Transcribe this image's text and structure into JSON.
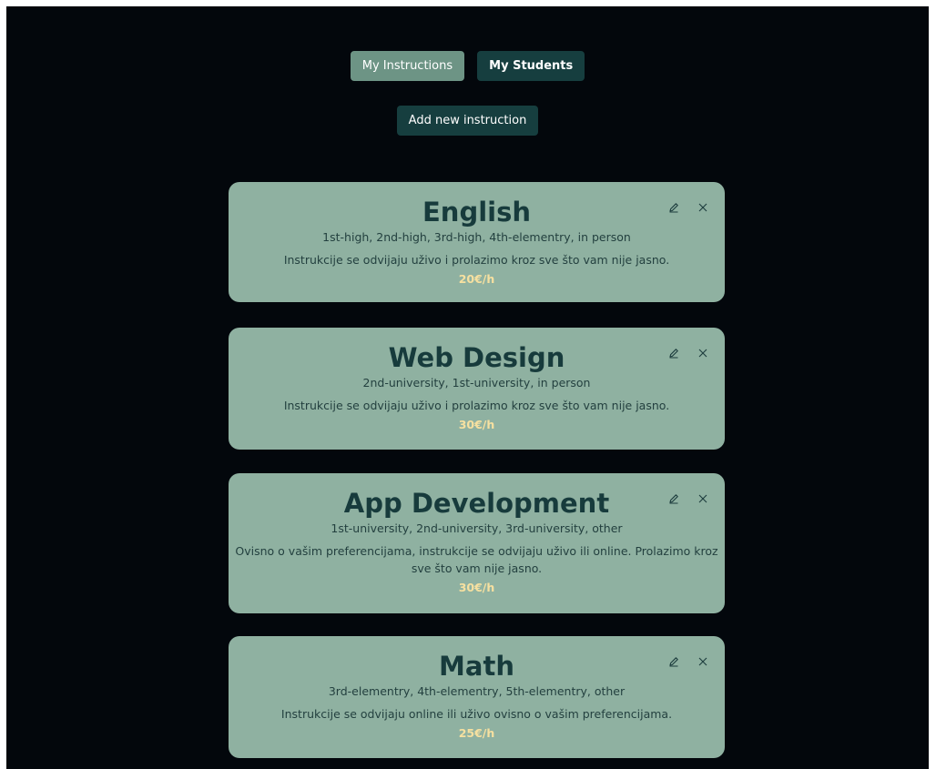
{
  "nav": {
    "my_instructions": "My Instructions",
    "my_students": "My Students",
    "add_new": "Add new instruction"
  },
  "colors": {
    "background": "#03070c",
    "card": "#8fb1a1",
    "active_button": "#6d9485",
    "dark_button": "#163e3f",
    "price": "#f6e0a0",
    "title": "#173b3c"
  },
  "instructions": [
    {
      "subject": "English",
      "levels": "1st-high, 2nd-high, 3rd-high, 4th-elementry, in person",
      "description": "Instrukcije se odvijaju uživo i prolazimo kroz sve što vam nije jasno.",
      "price": "20€/h",
      "edit_icon": "pencil-icon",
      "delete_icon": "close-icon"
    },
    {
      "subject": "Web Design",
      "levels": "2nd-university, 1st-university, in person",
      "description": "Instrukcije se odvijaju uživo i prolazimo kroz sve što vam nije jasno.",
      "price": "30€/h",
      "edit_icon": "pencil-icon",
      "delete_icon": "close-icon"
    },
    {
      "subject": "App Development",
      "levels": "1st-university, 2nd-university, 3rd-university, other",
      "description": "Ovisno o vašim preferencijama, instrukcije se odvijaju uživo ili online. Prolazimo kroz sve što vam nije jasno.",
      "price": "30€/h",
      "edit_icon": "pencil-icon",
      "delete_icon": "close-icon"
    },
    {
      "subject": "Math",
      "levels": "3rd-elementry, 4th-elementry, 5th-elementry, other",
      "description": "Instrukcije se odvijaju online ili uživo ovisno o vašim preferencijama.",
      "price": "25€/h",
      "edit_icon": "pencil-icon",
      "delete_icon": "close-icon"
    }
  ]
}
